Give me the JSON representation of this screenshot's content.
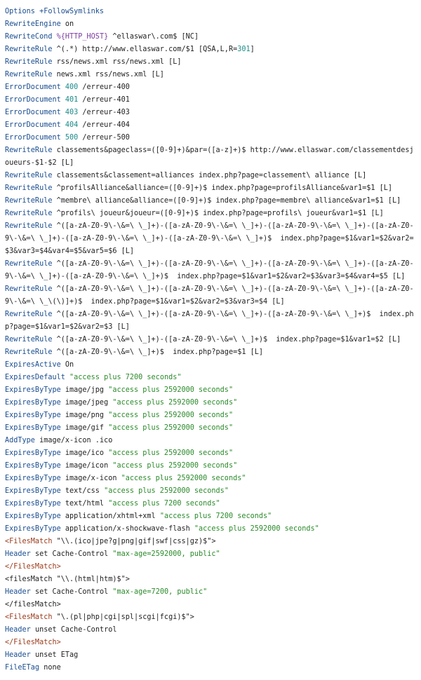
{
  "colors": {
    "directive": "#1a4d8f",
    "number": "#1b8a8a",
    "string": "#2a8a2a",
    "tag": "#9a3a1a",
    "variable": "#7a3aa0",
    "text": "#222222",
    "background": "#ffffff"
  },
  "lines": [
    [
      {
        "t": "Options +FollowSymlinks",
        "c": "directive"
      }
    ],
    [
      {
        "t": "RewriteEngine",
        "c": "directive"
      },
      {
        "t": " on",
        "c": "plain"
      }
    ],
    [
      {
        "t": "RewriteCond",
        "c": "directive"
      },
      {
        "t": " ",
        "c": "plain"
      },
      {
        "t": "%{HTTP_HOST}",
        "c": "variable"
      },
      {
        "t": " ^ellaswar\\.com$ [NC]",
        "c": "plain"
      }
    ],
    [
      {
        "t": "RewriteRule",
        "c": "directive"
      },
      {
        "t": " ^(.*) http://www.ellaswar.com/$1 [QSA,L,R=",
        "c": "plain"
      },
      {
        "t": "301",
        "c": "number"
      },
      {
        "t": "]",
        "c": "plain"
      }
    ],
    [
      {
        "t": "RewriteRule",
        "c": "directive"
      },
      {
        "t": " rss/news.xml rss/news.xml [L]",
        "c": "plain"
      }
    ],
    [
      {
        "t": "RewriteRule",
        "c": "directive"
      },
      {
        "t": " news.xml rss/news.xml [L]",
        "c": "plain"
      }
    ],
    [
      {
        "t": "ErrorDocument",
        "c": "directive"
      },
      {
        "t": " ",
        "c": "plain"
      },
      {
        "t": "400",
        "c": "number"
      },
      {
        "t": " /erreur-400",
        "c": "plain"
      }
    ],
    [
      {
        "t": "ErrorDocument",
        "c": "directive"
      },
      {
        "t": " ",
        "c": "plain"
      },
      {
        "t": "401",
        "c": "number"
      },
      {
        "t": " /erreur-401",
        "c": "plain"
      }
    ],
    [
      {
        "t": "ErrorDocument",
        "c": "directive"
      },
      {
        "t": " ",
        "c": "plain"
      },
      {
        "t": "403",
        "c": "number"
      },
      {
        "t": " /erreur-403",
        "c": "plain"
      }
    ],
    [
      {
        "t": "ErrorDocument",
        "c": "directive"
      },
      {
        "t": " ",
        "c": "plain"
      },
      {
        "t": "404",
        "c": "number"
      },
      {
        "t": " /erreur-404",
        "c": "plain"
      }
    ],
    [
      {
        "t": "ErrorDocument",
        "c": "directive"
      },
      {
        "t": " ",
        "c": "plain"
      },
      {
        "t": "500",
        "c": "number"
      },
      {
        "t": " /erreur-500",
        "c": "plain"
      }
    ],
    [
      {
        "t": "RewriteRule",
        "c": "directive"
      },
      {
        "t": " classements&pageclass=([0-9]+)&par=([a-z]+)$ http://www.ellaswar.com/classementdesjoueurs-$1-$2 [L]",
        "c": "plain"
      }
    ],
    [
      {
        "t": "RewriteRule",
        "c": "directive"
      },
      {
        "t": " classements&classement=alliances index.php?page=classement\\ alliance [L]",
        "c": "plain"
      }
    ],
    [
      {
        "t": "RewriteRule",
        "c": "directive"
      },
      {
        "t": " ^profilsAlliance&alliance=([0-9]+)$ index.php?page=profilsAlliance&var1=$1 [L]",
        "c": "plain"
      }
    ],
    [
      {
        "t": "RewriteRule",
        "c": "directive"
      },
      {
        "t": " ^membre\\ alliance&alliance=([0-9]+)$ index.php?page=membre\\ alliance&var1=$1 [L]",
        "c": "plain"
      }
    ],
    [
      {
        "t": "RewriteRule",
        "c": "directive"
      },
      {
        "t": " ^profils\\ joueur&joueur=([0-9]+)$ index.php?page=profils\\ joueur&var1=$1 [L]",
        "c": "plain"
      }
    ],
    [
      {
        "t": "RewriteRule",
        "c": "directive"
      },
      {
        "t": " ^([a-zA-Z0-9\\-\\&=\\ \\_]+)-([a-zA-Z0-9\\-\\&=\\ \\_]+)-([a-zA-Z0-9\\-\\&=\\ \\_]+)-([a-zA-Z0-9\\-\\&=\\ \\_]+)-([a-zA-Z0-9\\-\\&=\\ \\_]+)-([a-zA-Z0-9\\-\\&=\\ \\_]+)$  index.php?page=$1&var1=$2&var2=$3&var3=$4&var4=$5&var5=$6 [L]",
        "c": "plain"
      }
    ],
    [
      {
        "t": "RewriteRule",
        "c": "directive"
      },
      {
        "t": " ^([a-zA-Z0-9\\-\\&=\\ \\_]+)-([a-zA-Z0-9\\-\\&=\\ \\_]+)-([a-zA-Z0-9\\-\\&=\\ \\_]+)-([a-zA-Z0-9\\-\\&=\\ \\_]+)-([a-zA-Z0-9\\-\\&=\\ \\_]+)$  index.php?page=$1&var1=$2&var2=$3&var3=$4&var4=$5 [L]",
        "c": "plain"
      }
    ],
    [
      {
        "t": "RewriteRule",
        "c": "directive"
      },
      {
        "t": " ^([a-zA-Z0-9\\-\\&=\\ \\_]+)-([a-zA-Z0-9\\-\\&=\\ \\_]+)-([a-zA-Z0-9\\-\\&=\\ \\_]+)-([a-zA-Z0-9\\-\\&=\\ \\_\\(\\)]+)$  index.php?page=$1&var1=$2&var2=$3&var3=$4 [L]",
        "c": "plain"
      }
    ],
    [
      {
        "t": "RewriteRule",
        "c": "directive"
      },
      {
        "t": " ^([a-zA-Z0-9\\-\\&=\\ \\_]+)-([a-zA-Z0-9\\-\\&=\\ \\_]+)-([a-zA-Z0-9\\-\\&=\\ \\_]+)$  index.php?page=$1&var1=$2&var2=$3 [L]",
        "c": "plain"
      }
    ],
    [
      {
        "t": "RewriteRule",
        "c": "directive"
      },
      {
        "t": " ^([a-zA-Z0-9\\-\\&=\\ \\_]+)-([a-zA-Z0-9\\-\\&=\\ \\_]+)$  index.php?page=$1&var1=$2 [L]",
        "c": "plain"
      }
    ],
    [
      {
        "t": "RewriteRule",
        "c": "directive"
      },
      {
        "t": " ^([a-zA-Z0-9\\-\\&=\\ \\_]+)$  index.php?page=$1 [L]",
        "c": "plain"
      }
    ],
    [
      {
        "t": "ExpiresActive",
        "c": "directive"
      },
      {
        "t": " On",
        "c": "plain"
      }
    ],
    [
      {
        "t": "ExpiresDefault",
        "c": "directive"
      },
      {
        "t": " ",
        "c": "plain"
      },
      {
        "t": "\"access plus 7200 seconds\"",
        "c": "string"
      }
    ],
    [
      {
        "t": "ExpiresByType",
        "c": "directive"
      },
      {
        "t": " image/jpg ",
        "c": "plain"
      },
      {
        "t": "\"access plus 2592000 seconds\"",
        "c": "string"
      }
    ],
    [
      {
        "t": "ExpiresByType",
        "c": "directive"
      },
      {
        "t": " image/jpeg ",
        "c": "plain"
      },
      {
        "t": "\"access plus 2592000 seconds\"",
        "c": "string"
      }
    ],
    [
      {
        "t": "ExpiresByType",
        "c": "directive"
      },
      {
        "t": " image/png ",
        "c": "plain"
      },
      {
        "t": "\"access plus 2592000 seconds\"",
        "c": "string"
      }
    ],
    [
      {
        "t": "ExpiresByType",
        "c": "directive"
      },
      {
        "t": " image/gif ",
        "c": "plain"
      },
      {
        "t": "\"access plus 2592000 seconds\"",
        "c": "string"
      }
    ],
    [
      {
        "t": "AddType",
        "c": "directive"
      },
      {
        "t": " image/x-icon .ico",
        "c": "plain"
      }
    ],
    [
      {
        "t": "ExpiresByType",
        "c": "directive"
      },
      {
        "t": " image/ico ",
        "c": "plain"
      },
      {
        "t": "\"access plus 2592000 seconds\"",
        "c": "string"
      }
    ],
    [
      {
        "t": "ExpiresByType",
        "c": "directive"
      },
      {
        "t": " image/icon ",
        "c": "plain"
      },
      {
        "t": "\"access plus 2592000 seconds\"",
        "c": "string"
      }
    ],
    [
      {
        "t": "ExpiresByType",
        "c": "directive"
      },
      {
        "t": " image/x-icon ",
        "c": "plain"
      },
      {
        "t": "\"access plus 2592000 seconds\"",
        "c": "string"
      }
    ],
    [
      {
        "t": "ExpiresByType",
        "c": "directive"
      },
      {
        "t": " text/css ",
        "c": "plain"
      },
      {
        "t": "\"access plus 2592000 seconds\"",
        "c": "string"
      }
    ],
    [
      {
        "t": "ExpiresByType",
        "c": "directive"
      },
      {
        "t": " text/html ",
        "c": "plain"
      },
      {
        "t": "\"access plus 7200 seconds\"",
        "c": "string"
      }
    ],
    [
      {
        "t": "ExpiresByType",
        "c": "directive"
      },
      {
        "t": " application/xhtml+xml ",
        "c": "plain"
      },
      {
        "t": "\"access plus 7200 seconds\"",
        "c": "string"
      }
    ],
    [
      {
        "t": "ExpiresByType",
        "c": "directive"
      },
      {
        "t": " application/x-shockwave-flash ",
        "c": "plain"
      },
      {
        "t": "\"access plus 2592000 seconds\"",
        "c": "string"
      }
    ],
    [
      {
        "t": "<FilesMatch",
        "c": "tag"
      },
      {
        "t": " \"\\\\.(ico|jpe?g|png|gif|swf|css|gz)$\">",
        "c": "plain"
      }
    ],
    [
      {
        "t": "Header",
        "c": "directive"
      },
      {
        "t": " set Cache-Control ",
        "c": "plain"
      },
      {
        "t": "\"max-age=2592000, public\"",
        "c": "string"
      }
    ],
    [
      {
        "t": "</FilesMatch>",
        "c": "tag"
      }
    ],
    [
      {
        "t": "<filesMatch \"\\\\.(html|htm)$\">",
        "c": "plain"
      }
    ],
    [
      {
        "t": "Header",
        "c": "directive"
      },
      {
        "t": " set Cache-Control ",
        "c": "plain"
      },
      {
        "t": "\"max-age=7200, public\"",
        "c": "string"
      }
    ],
    [
      {
        "t": "</filesMatch>",
        "c": "plain"
      }
    ],
    [
      {
        "t": "<FilesMatch",
        "c": "tag"
      },
      {
        "t": " \"\\.(pl|php|cgi|spl|scgi|fcgi)$\">",
        "c": "plain"
      }
    ],
    [
      {
        "t": "Header",
        "c": "directive"
      },
      {
        "t": " unset Cache-Control",
        "c": "plain"
      }
    ],
    [
      {
        "t": "</FilesMatch>",
        "c": "tag"
      }
    ],
    [
      {
        "t": "Header",
        "c": "directive"
      },
      {
        "t": " unset ETag",
        "c": "plain"
      }
    ],
    [
      {
        "t": "FileETag",
        "c": "directive"
      },
      {
        "t": " none",
        "c": "plain"
      }
    ]
  ]
}
